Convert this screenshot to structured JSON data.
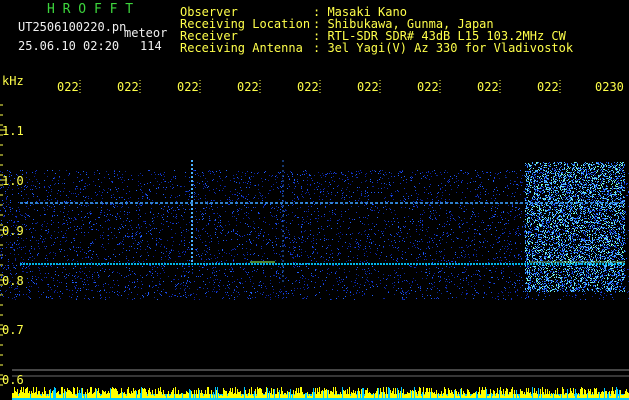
{
  "header": {
    "app_name": "H R O F F T",
    "filename": "UT2506100220.pn",
    "mode": "meteor",
    "datetime": "25.06.10 02:20",
    "count": "114",
    "info_labels": [
      "Observer",
      "Receiving Location",
      "Receiver",
      "Receiving Antenna"
    ],
    "info_values": [
      ": Masaki Kano",
      ": Shibukawa, Gunma, Japan",
      ": RTL-SDR SDR# 43dB L15 103.2MHz CW",
      ": 3el Yagi(V) Az 330 for Vladivostok"
    ]
  },
  "spectrogram": {
    "y_unit": "kHz",
    "y_ticks": [
      "1.1",
      "1.0",
      "0.9",
      "0.8",
      "0.7",
      "0.6"
    ],
    "time_ticks": [
      "022",
      "022",
      "022",
      "022",
      "022",
      "022",
      "022",
      "022",
      "022",
      "0230"
    ],
    "colors": {
      "background": "#000000",
      "label": "#ffff4a",
      "title": "#3dd63d",
      "signal": "#2060ff",
      "baseline": "#00c8ff",
      "peak": "#ffff00"
    }
  }
}
